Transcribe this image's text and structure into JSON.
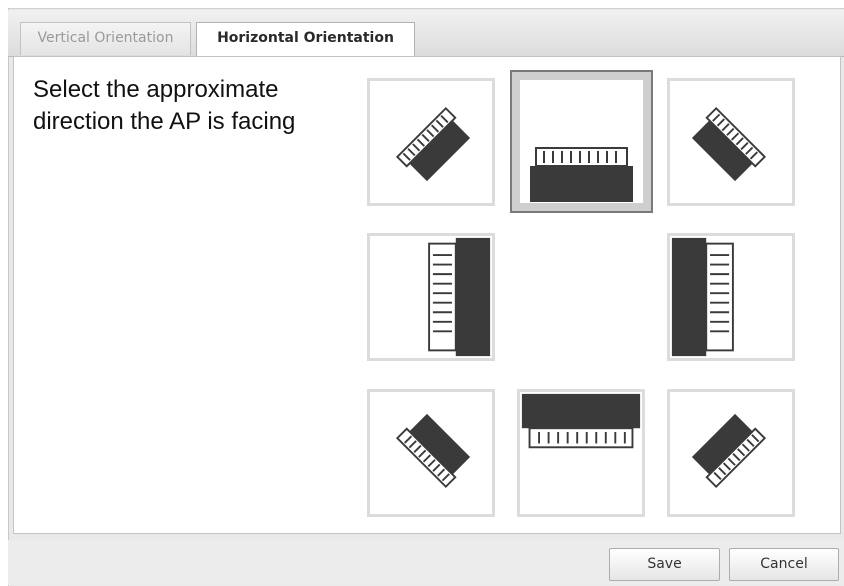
{
  "tabs": [
    {
      "label": "Vertical Orientation",
      "active": false
    },
    {
      "label": "Horizontal Orientation",
      "active": true
    }
  ],
  "prompt": "Select the approximate direction the AP is facing",
  "directions": [
    {
      "id": "north-west",
      "icon": "ap-facing-north-west-icon",
      "selected": false
    },
    {
      "id": "north",
      "icon": "ap-facing-north-icon",
      "selected": true
    },
    {
      "id": "north-east",
      "icon": "ap-facing-north-east-icon",
      "selected": false
    },
    {
      "id": "west",
      "icon": "ap-facing-west-icon",
      "selected": false
    },
    {
      "id": "east",
      "icon": "ap-facing-east-icon",
      "selected": false
    },
    {
      "id": "south-west",
      "icon": "ap-facing-south-west-icon",
      "selected": false
    },
    {
      "id": "south",
      "icon": "ap-facing-south-icon",
      "selected": false
    },
    {
      "id": "south-east",
      "icon": "ap-facing-south-east-icon",
      "selected": false
    }
  ],
  "buttons": {
    "save": "Save",
    "cancel": "Cancel"
  },
  "colors": {
    "ap_fill": "#3a3a3a",
    "selection": "#cfcfcf",
    "tile_border": "#dcdcdc"
  }
}
